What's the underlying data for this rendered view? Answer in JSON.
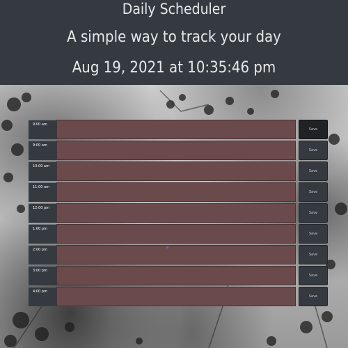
{
  "header": {
    "title": "Daily Scheduler",
    "subtitle": "A simple way to track your day",
    "current_datetime": "Aug 19, 2021 at 10:35:46 pm"
  },
  "rows": [
    {
      "hour": "9:00 am",
      "save_label": "Save"
    },
    {
      "hour": "9:00 am",
      "save_label": "Save"
    },
    {
      "hour": "10:00 am",
      "save_label": "Save"
    },
    {
      "hour": "11:00 am",
      "save_label": "Save"
    },
    {
      "hour": "12:00 pm",
      "save_label": "Save"
    },
    {
      "hour": "1:00 pm",
      "save_label": "Save"
    },
    {
      "hour": "2:00 pm",
      "save_label": "Save"
    },
    {
      "hour": "3:00 pm",
      "save_label": "Save"
    },
    {
      "hour": "4:00 pm",
      "save_label": "Save"
    }
  ],
  "colors": {
    "header_bg": "#343a40",
    "past_row": "#6b4a4c",
    "save_button": "#343a40"
  }
}
